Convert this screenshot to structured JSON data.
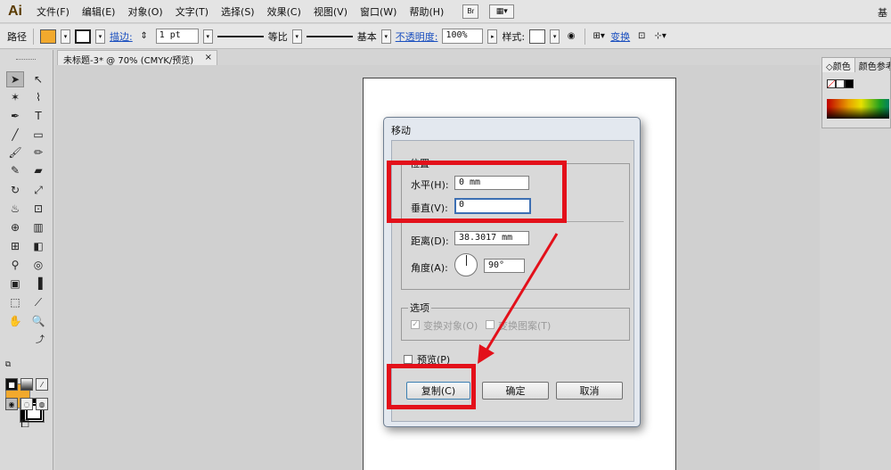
{
  "menubar": {
    "logo": "Ai",
    "items": [
      "文件(F)",
      "编辑(E)",
      "对象(O)",
      "文字(T)",
      "选择(S)",
      "效果(C)",
      "视图(V)",
      "窗口(W)",
      "帮助(H)"
    ],
    "bridge": "Br",
    "right_text": "基"
  },
  "controlbar": {
    "selection_label": "路径",
    "stroke_link": "描边:",
    "stroke_weight": "1 pt",
    "profile_label": "等比",
    "brush_label": "基本",
    "opacity_link": "不透明度:",
    "opacity_value": "100%",
    "style_label": "样式:",
    "transform_link": "变换",
    "fill_color": "#f2a92d"
  },
  "document_tab": {
    "title": "未标题-3* @ 70% (CMYK/预览)",
    "close": "×"
  },
  "color_panel": {
    "tab_color": "颜色",
    "tab_guide": "颜色参考"
  },
  "dialog": {
    "title": "移动",
    "position_group": "位置",
    "horizontal_label": "水平(H):",
    "horizontal_value": "0 mm",
    "vertical_label": "垂直(V):",
    "vertical_value": "0",
    "distance_label": "距离(D):",
    "distance_value": "38.3017 mm",
    "angle_label": "角度(A):",
    "angle_value": "90°",
    "options_group": "选项",
    "transform_objects": "变换对象(O)",
    "transform_patterns": "变换图案(T)",
    "preview_label": "预览(P)",
    "copy_button": "复制(C)",
    "ok_button": "确定",
    "cancel_button": "取消"
  },
  "annotation_color": "#e3101a"
}
